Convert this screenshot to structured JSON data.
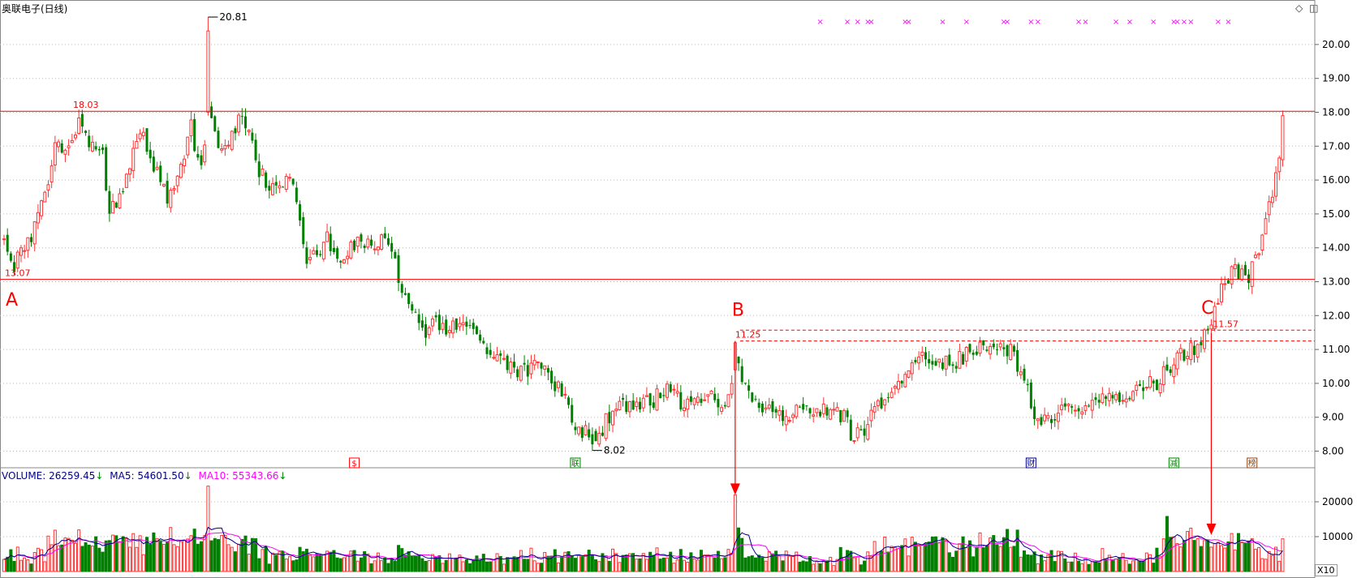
{
  "title": "奥联电子(日线)",
  "chart_data": {
    "type": "candlestick",
    "price_axis": {
      "ticks": [
        8,
        9,
        10,
        11,
        12,
        13,
        14,
        15,
        16,
        17,
        18,
        19,
        20
      ],
      "labels": [
        "8.00",
        "9.00",
        "10.00",
        "11.00",
        "12.00",
        "13.00",
        "14.00",
        "15.00",
        "16.00",
        "17.00",
        "18.00",
        "19.00",
        "20.00"
      ],
      "range": [
        7.6,
        21.3
      ]
    },
    "volume_axis": {
      "ticks": [
        10000,
        20000
      ],
      "labels": [
        "10000",
        "20000"
      ],
      "range": [
        0,
        29000
      ],
      "unit_label": "X10"
    },
    "colors": {
      "up": "#ff3333",
      "down": "#008000",
      "ma5": "#00008b",
      "ma10": "#ff00ff",
      "annotation": "#ff0000",
      "marker": "#ff00ff"
    },
    "levels": [
      {
        "price": 18.03,
        "label": "18.03",
        "style": "solid"
      },
      {
        "price": 13.07,
        "label": "13.07",
        "style": "solid"
      },
      {
        "price": 11.25,
        "label": "11.25",
        "style": "dashed"
      },
      {
        "price": 11.57,
        "label": "11.57",
        "style": "dashed"
      }
    ],
    "extremes": [
      {
        "label": "20.81",
        "price": 20.81,
        "type": "high",
        "index": 60
      },
      {
        "label": "8.02",
        "price": 8.02,
        "type": "low",
        "index": 173
      }
    ],
    "points": [
      {
        "label": "A",
        "index": 0,
        "price": 12.3
      },
      {
        "label": "B",
        "index": 215,
        "price": 12.0
      },
      {
        "label": "C",
        "index": 353,
        "price": 12.05
      }
    ],
    "arrows": [
      {
        "index": 215,
        "from_price": 11.25,
        "to_volume": 22000
      },
      {
        "index": 355,
        "from_price": 11.5,
        "to_volume": 10500
      }
    ],
    "event_markers": [
      {
        "label": "$",
        "index": 103,
        "color": "#ff0000"
      },
      {
        "label": "联",
        "index": 168,
        "color": "#008000"
      },
      {
        "label": "财",
        "index": 302,
        "color": "#00008b"
      },
      {
        "label": "减",
        "index": 344,
        "color": "#008000"
      },
      {
        "label": "榜",
        "index": 367,
        "color": "#8b4513"
      }
    ],
    "cross_marks_indices": [
      240,
      248,
      251,
      254,
      255,
      265,
      266,
      276,
      283,
      294,
      295,
      302,
      304,
      316,
      318,
      327,
      331,
      338,
      344,
      345,
      347,
      349,
      357,
      360
    ],
    "volume_legend": {
      "volume": "VOLUME: 26259.45",
      "ma5": "MA5: 54601.50",
      "ma10": "MA10: 55343.66"
    },
    "anchors": [
      [
        0,
        14.2
      ],
      [
        3,
        13.5
      ],
      [
        8,
        14.4
      ],
      [
        12,
        15.4
      ],
      [
        15,
        17.3
      ],
      [
        18,
        16.9
      ],
      [
        22,
        17.8
      ],
      [
        25,
        17.0
      ],
      [
        29,
        16.7
      ],
      [
        31,
        15.1
      ],
      [
        33,
        15.3
      ],
      [
        37,
        16.5
      ],
      [
        41,
        17.3
      ],
      [
        44,
        16.4
      ],
      [
        48,
        15.5
      ],
      [
        52,
        16.3
      ],
      [
        55,
        17.5
      ],
      [
        58,
        16.2
      ],
      [
        60,
        18.2
      ],
      [
        63,
        17.0
      ],
      [
        67,
        17.4
      ],
      [
        70,
        18.1
      ],
      [
        72,
        17.3
      ],
      [
        75,
        16.3
      ],
      [
        80,
        15.6
      ],
      [
        83,
        16.3
      ],
      [
        86,
        15.5
      ],
      [
        89,
        13.5
      ],
      [
        92,
        13.9
      ],
      [
        95,
        14.2
      ],
      [
        98,
        13.6
      ],
      [
        103,
        14.1
      ],
      [
        108,
        14.0
      ],
      [
        112,
        14.2
      ],
      [
        116,
        13.2
      ],
      [
        120,
        12.0
      ],
      [
        124,
        11.6
      ],
      [
        128,
        11.8
      ],
      [
        134,
        11.5
      ],
      [
        139,
        11.7
      ],
      [
        143,
        10.9
      ],
      [
        147,
        10.6
      ],
      [
        152,
        10.3
      ],
      [
        157,
        10.5
      ],
      [
        161,
        10.1
      ],
      [
        165,
        9.7
      ],
      [
        168,
        8.8
      ],
      [
        172,
        8.4
      ],
      [
        175,
        8.6
      ],
      [
        180,
        9.2
      ],
      [
        185,
        9.4
      ],
      [
        190,
        9.5
      ],
      [
        196,
        9.8
      ],
      [
        201,
        9.3
      ],
      [
        206,
        9.6
      ],
      [
        212,
        9.4
      ],
      [
        215,
        10.6
      ],
      [
        218,
        9.9
      ],
      [
        222,
        9.5
      ],
      [
        226,
        9.0
      ],
      [
        231,
        9.1
      ],
      [
        236,
        9.3
      ],
      [
        241,
        9.2
      ],
      [
        246,
        9.1
      ],
      [
        250,
        8.4
      ],
      [
        253,
        8.7
      ],
      [
        257,
        9.4
      ],
      [
        261,
        9.9
      ],
      [
        265,
        10.3
      ],
      [
        270,
        10.8
      ],
      [
        274,
        10.6
      ],
      [
        280,
        10.7
      ],
      [
        285,
        11.0
      ],
      [
        290,
        11.2
      ],
      [
        296,
        10.9
      ],
      [
        300,
        10.2
      ],
      [
        304,
        8.8
      ],
      [
        308,
        8.9
      ],
      [
        312,
        9.3
      ],
      [
        316,
        9.1
      ],
      [
        320,
        9.3
      ],
      [
        325,
        9.5
      ],
      [
        330,
        9.7
      ],
      [
        335,
        9.9
      ],
      [
        339,
        10.0
      ],
      [
        343,
        10.5
      ],
      [
        347,
        10.9
      ],
      [
        351,
        11.1
      ],
      [
        355,
        11.6
      ],
      [
        358,
        12.8
      ],
      [
        362,
        13.3
      ],
      [
        366,
        13.2
      ],
      [
        369,
        13.9
      ],
      [
        371,
        15.0
      ],
      [
        374,
        16.0
      ],
      [
        376,
        17.5
      ]
    ]
  }
}
